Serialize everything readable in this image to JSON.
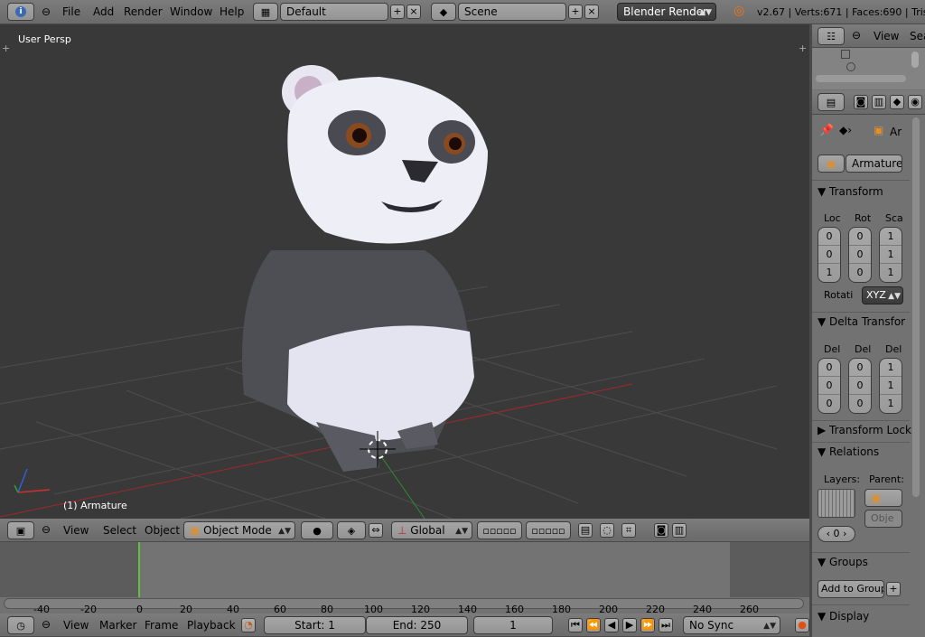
{
  "topbar": {
    "menus": [
      "File",
      "Add",
      "Render",
      "Window",
      "Help"
    ],
    "screen_layout": "Default",
    "scene": "Scene",
    "render_engine": "Blender Render",
    "stats": "v2.67 | Verts:671 | Faces:690 | Tris:1"
  },
  "viewport": {
    "view_label": "User Persp",
    "object_label": "(1) Armature"
  },
  "view3d_header": {
    "menus": [
      "View",
      "Select",
      "Object"
    ],
    "mode": "Object Mode",
    "orientation": "Global"
  },
  "timeline": {
    "ticks": [
      "-40",
      "-20",
      "0",
      "20",
      "40",
      "60",
      "80",
      "100",
      "120",
      "140",
      "160",
      "180",
      "200",
      "220",
      "240",
      "260"
    ],
    "menus": [
      "View",
      "Marker",
      "Frame",
      "Playback"
    ],
    "start": "Start: 1",
    "end": "End: 250",
    "current_frame": "1",
    "sync": "No Sync"
  },
  "outliner": {
    "view_label": "View",
    "search_label": "Sea"
  },
  "properties": {
    "breadcrumb": "Ar",
    "object_name": "Armature",
    "transform": {
      "title": "Transform",
      "headers": [
        "Loc",
        "Rot",
        "Sca"
      ],
      "loc": [
        "0",
        "0",
        "1"
      ],
      "rot": [
        "0",
        "0",
        "0"
      ],
      "scale": [
        "1",
        "1",
        "1"
      ],
      "rotation_label": "Rotati",
      "rotation_mode": "XYZ"
    },
    "delta": {
      "title": "Delta Transfor",
      "headers": [
        "Del",
        "Del",
        "Del"
      ],
      "col1": [
        "0",
        "0",
        "0"
      ],
      "col2": [
        "0",
        "0",
        "0"
      ],
      "col3": [
        "1",
        "1",
        "1"
      ]
    },
    "transform_locks": "Transform Lock",
    "relations": {
      "title": "Relations",
      "layers_label": "Layers:",
      "parent_label": "Parent:",
      "parent_type": "Obje",
      "pass_index": "0"
    },
    "groups": {
      "title": "Groups",
      "add_button": "Add to Group"
    },
    "display": {
      "title": "Display"
    }
  },
  "colors": {
    "background": "#393939",
    "accent": "#f47216",
    "frame_marker": "#60c040"
  }
}
